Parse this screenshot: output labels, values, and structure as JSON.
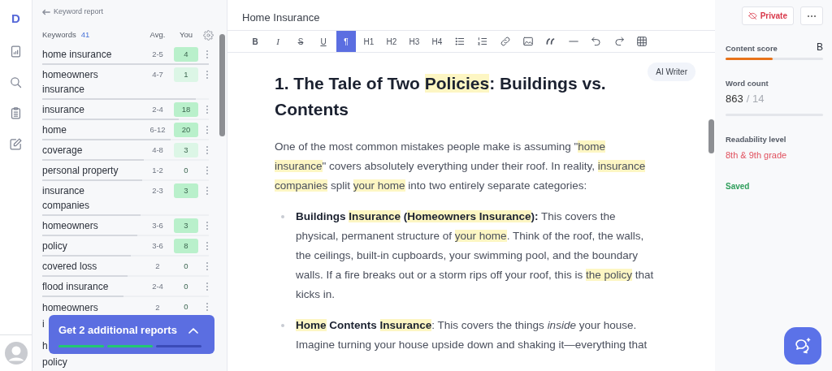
{
  "sidebar": {
    "logo": "D",
    "nav": [
      {
        "kind": "report",
        "selected": false
      },
      {
        "kind": "search",
        "selected": false
      },
      {
        "kind": "clipboard",
        "selected": false
      },
      {
        "kind": "edit",
        "selected": false
      }
    ]
  },
  "keyword_panel": {
    "back_link": "Keyword report",
    "header": {
      "keywords": "Keywords",
      "count": "41",
      "avg": "Avg.",
      "you": "You"
    },
    "rows": [
      {
        "lines": [
          "home insurance"
        ],
        "avg": "2-5",
        "you": "4",
        "color": "#b9f0cb",
        "level": 1.0
      },
      {
        "lines": [
          "homeowners",
          "insurance"
        ],
        "avg": "4-7",
        "you": "1",
        "color": "#dcf6e6",
        "level": 0.92
      },
      {
        "lines": [
          "insurance"
        ],
        "avg": "2-4",
        "you": "18",
        "color": "#b9f0cb",
        "level": 0.82
      },
      {
        "lines": [
          "home"
        ],
        "avg": "6-12",
        "you": "20",
        "color": "#b9f0cb",
        "level": 0.77
      },
      {
        "lines": [
          "coverage"
        ],
        "avg": "4-8",
        "you": "3",
        "color": "#dcf6e6",
        "level": 0.61
      },
      {
        "lines": [
          "personal property"
        ],
        "avg": "1-2",
        "you": "0",
        "level": 0.6
      },
      {
        "lines": [
          "insurance",
          "companies"
        ],
        "avg": "2-3",
        "you": "3",
        "color": "#b9f0cb",
        "level": 0.59
      },
      {
        "lines": [
          "homeowners"
        ],
        "avg": "3-6",
        "you": "3",
        "color": "#b9f0cb",
        "level": 0.57
      },
      {
        "lines": [
          "policy"
        ],
        "avg": "3-6",
        "you": "8",
        "color": "#b9f0cb",
        "level": 0.53
      },
      {
        "lines": [
          "covered loss"
        ],
        "avg": "2",
        "you": "0",
        "level": 0.51
      },
      {
        "lines": [
          "flood insurance"
        ],
        "avg": "2-4",
        "you": "0",
        "level": 0.49
      },
      {
        "lines": [
          "homeowners",
          "i"
        ],
        "avg": "2",
        "you": "0"
      },
      {
        "lines": [
          "h",
          "policy"
        ]
      }
    ],
    "promo": {
      "text": "Get 2 additional reports",
      "steps": [
        {
          "done": true
        },
        {
          "done": true
        },
        {
          "done": false
        }
      ]
    }
  },
  "editor": {
    "title": "Home Insurance",
    "toolbar": [
      {
        "kind": "bold",
        "label": "B",
        "selected": false
      },
      {
        "kind": "italic",
        "label": "I",
        "selected": false
      },
      {
        "kind": "strike",
        "label": "S",
        "selected": false
      },
      {
        "kind": "underline",
        "label": "U",
        "selected": false
      },
      {
        "kind": "text",
        "label": "¶",
        "selected": true
      },
      {
        "kind": "text",
        "label": "H1",
        "selected": false
      },
      {
        "kind": "text",
        "label": "H2",
        "selected": false
      },
      {
        "kind": "text",
        "label": "H3",
        "selected": false
      },
      {
        "kind": "text",
        "label": "H4",
        "selected": false
      },
      {
        "kind": "bullets",
        "selected": false
      },
      {
        "kind": "numbers",
        "selected": false
      },
      {
        "kind": "link",
        "selected": false
      },
      {
        "kind": "image",
        "selected": false
      },
      {
        "kind": "quote",
        "selected": false
      },
      {
        "kind": "rule",
        "selected": false
      },
      {
        "kind": "undo",
        "selected": false
      },
      {
        "kind": "redo",
        "selected": false
      },
      {
        "kind": "table",
        "selected": false
      }
    ],
    "ai_writer": "AI Writer",
    "blocks": [
      {
        "kind": "heading",
        "segments": [
          {
            "text": "1. The Tale of Two "
          },
          {
            "text": "Policies",
            "highlight": true
          },
          {
            "text": ": Buildings vs. Contents"
          }
        ]
      },
      {
        "kind": "paragraph",
        "segments": [
          {
            "text": "One of the most common mistakes people make is assuming \""
          },
          {
            "text": "home insurance",
            "highlight": true
          },
          {
            "text": "\" covers absolutely everything under their roof. In reality, "
          },
          {
            "text": "insurance companies",
            "highlight": true
          },
          {
            "text": " split "
          },
          {
            "text": "your home",
            "highlight": true
          },
          {
            "text": " into two entirely separate categories:"
          }
        ]
      },
      {
        "kind": "bullet",
        "segments": [
          {
            "text": "Buildings ",
            "bold": true
          },
          {
            "text": "Insurance",
            "bold": true,
            "highlight": true
          },
          {
            "text": " (",
            "bold": true
          },
          {
            "text": "Homeowners Insurance",
            "bold": true,
            "highlight": true
          },
          {
            "text": "):",
            "bold": true
          },
          {
            "text": " This covers the physical, permanent structure of "
          },
          {
            "text": "your home",
            "highlight": true
          },
          {
            "text": ". Think of the roof, the walls, the ceilings, built-in cupboards, your swimming pool, and the boundary walls. If a fire breaks out or a storm rips off your roof, this is "
          },
          {
            "text": "the policy",
            "highlight": true
          },
          {
            "text": " that kicks in."
          }
        ]
      },
      {
        "kind": "bullet",
        "segments": [
          {
            "text": "Home",
            "bold": true,
            "highlight": true
          },
          {
            "text": " Contents ",
            "bold": true
          },
          {
            "text": "Insurance",
            "bold": true,
            "highlight": true
          },
          {
            "text": ": This covers the things "
          },
          {
            "text": "inside",
            "italic": true
          },
          {
            "text": " your house. Imagine turning your house upside down and shaking it—everything that"
          }
        ]
      }
    ]
  },
  "stats": {
    "private_button": "Private",
    "content_score": {
      "label": "Content score",
      "grade": "B",
      "level": 0.48
    },
    "word_count": {
      "label": "Word count",
      "value": "863",
      "target": "/ 14"
    },
    "readability": {
      "label": "Readability level",
      "value": "8th & 9th grade"
    },
    "save_status": "Saved"
  }
}
